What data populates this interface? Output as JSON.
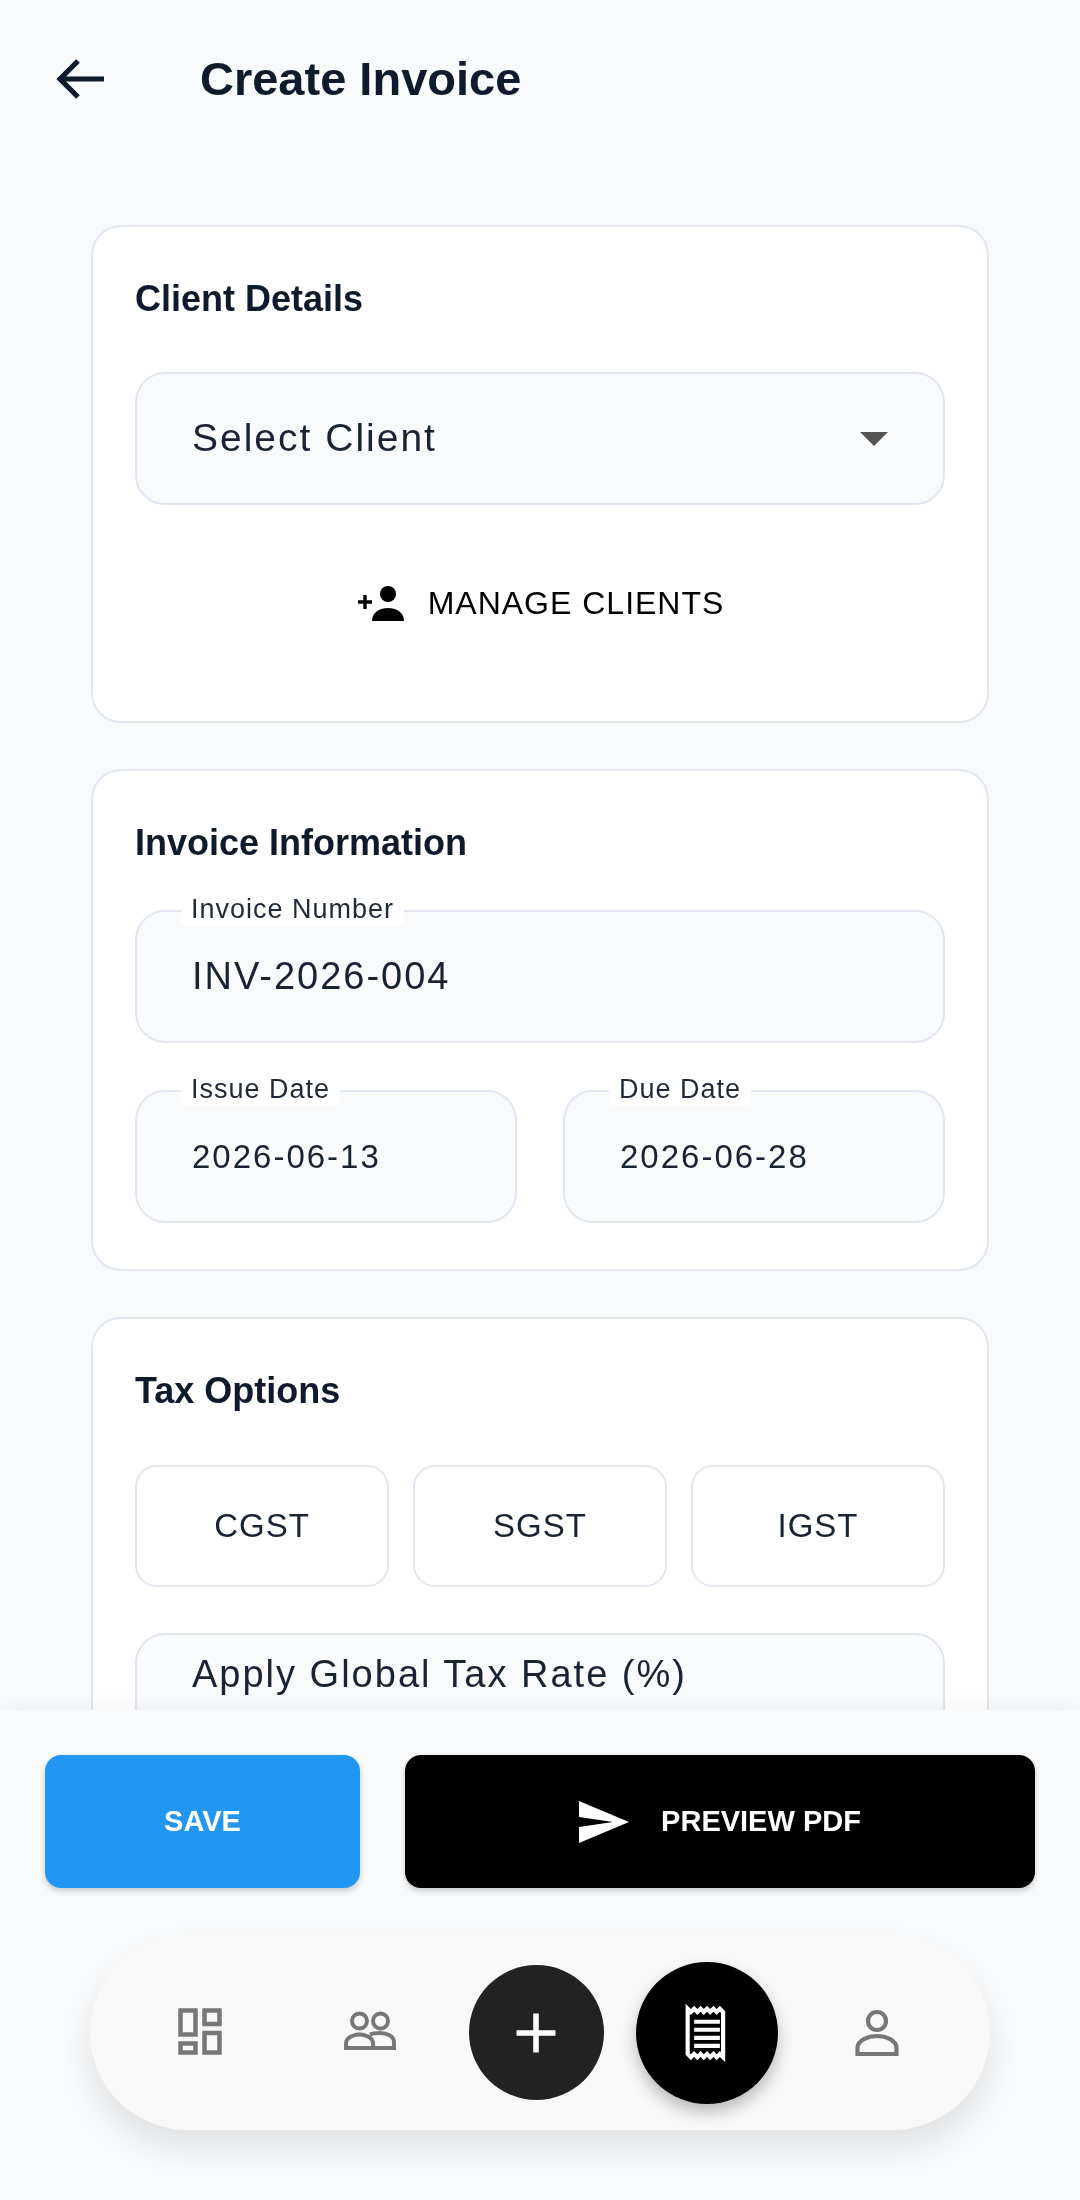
{
  "header": {
    "title": "Create Invoice"
  },
  "client_details": {
    "title": "Client Details",
    "client_select": {
      "placeholder": "Select Client"
    },
    "manage_button": "MANAGE CLIENTS"
  },
  "invoice_information": {
    "title": "Invoice Information",
    "invoice_number": {
      "label": "Invoice Number",
      "value": "INV-2026-004"
    },
    "issue_date": {
      "label": "Issue Date",
      "value": "2026-06-13"
    },
    "due_date": {
      "label": "Due Date",
      "value": "2026-06-28"
    }
  },
  "tax_options": {
    "title": "Tax Options",
    "options": [
      {
        "label": "CGST",
        "selected": false
      },
      {
        "label": "SGST",
        "selected": false
      },
      {
        "label": "IGST",
        "selected": false
      }
    ],
    "global_tax_rate": {
      "placeholder": "Apply Global Tax Rate (%)"
    }
  },
  "actions": {
    "save": "SAVE",
    "preview": "PREVIEW PDF"
  },
  "bottom_nav": {
    "items": [
      {
        "kind": "tab",
        "selected": false
      },
      {
        "kind": "tab",
        "selected": false
      },
      {
        "kind": "fab",
        "selected": false
      },
      {
        "kind": "tab",
        "selected": true
      },
      {
        "kind": "tab",
        "selected": false
      }
    ]
  }
}
